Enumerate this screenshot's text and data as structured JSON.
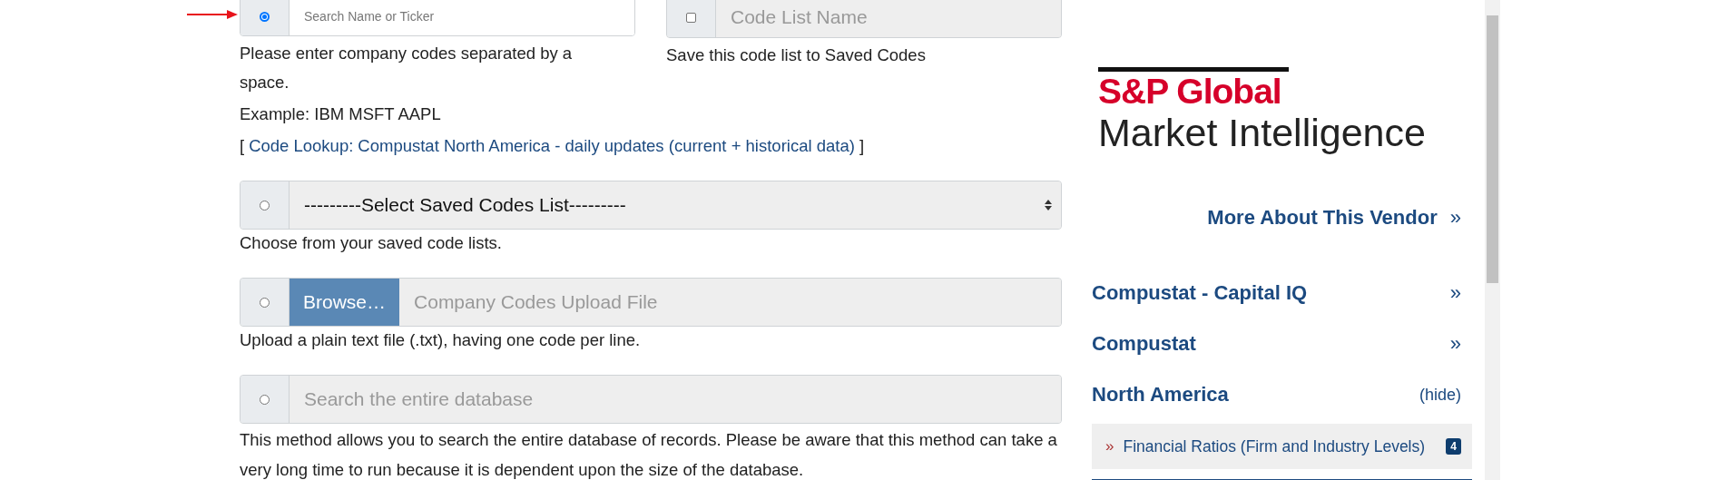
{
  "code_entry": {
    "selected": true,
    "placeholder": "Search Name or Ticker",
    "help": "Please enter company codes separated by a space.",
    "example": "Example: IBM MSFT AAPL",
    "lookup": {
      "open": "[",
      "label": "Code Lookup",
      "sep": ":",
      "link": "Compustat North America - daily updates (current + historical data)",
      "close": "]"
    }
  },
  "save_list": {
    "checked": false,
    "placeholder": "Code List Name",
    "help": "Save this code list to Saved Codes"
  },
  "methods": [
    {
      "kind": "select",
      "selected": false,
      "value": "---------Select Saved Codes List---------",
      "help": "Choose from your saved code lists."
    },
    {
      "kind": "file",
      "selected": false,
      "button": "Browse…",
      "placeholder": "Company Codes Upload File",
      "help": "Upload a plain text file (.txt), having one code per line."
    },
    {
      "kind": "input",
      "selected": false,
      "placeholder": "Search the entire database",
      "help": "This method allows you to search the entire database of records. Please be aware that this method can take a very long time to run because it is dependent upon the size of the database."
    }
  ],
  "sidebar": {
    "logo": {
      "line1": "S&P Global",
      "line2": "Market Intelligence"
    },
    "vendor_link": {
      "label": "More About This Vendor",
      "icon": "»"
    },
    "nav": [
      {
        "label": "Compustat - Capital IQ",
        "action": "»"
      },
      {
        "label": "Compustat",
        "action": "»"
      },
      {
        "label": "North America",
        "action": "(hide)"
      }
    ],
    "items": [
      {
        "marker": "»",
        "label": "Financial Ratios (Firm and Industry Levels)",
        "badge": "4"
      }
    ]
  }
}
